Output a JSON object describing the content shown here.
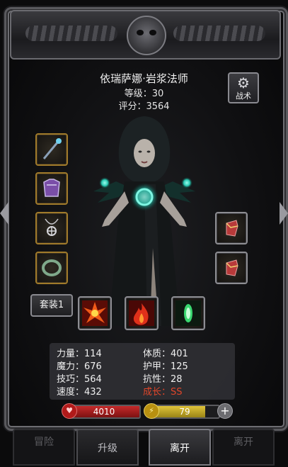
{
  "character": {
    "name": "依瑞萨娜·岩浆法师",
    "level": "等级：30",
    "score": "评分：3564"
  },
  "tactics_button": {
    "label": "战术",
    "icon": "gear-icon"
  },
  "equipment_slots": [
    {
      "slot": "weapon",
      "icon": "staff-icon"
    },
    {
      "slot": "armor",
      "icon": "chest-armor-icon"
    },
    {
      "slot": "amulet",
      "icon": "amulet-icon"
    },
    {
      "slot": "ring",
      "icon": "ring-icon"
    }
  ],
  "consumable_slots": [
    {
      "icon": "potion-pouch-icon"
    },
    {
      "icon": "potion-pouch-icon"
    }
  ],
  "set_button": {
    "label": "套装1"
  },
  "skills": [
    {
      "icon": "fire-burst-icon",
      "color": "#e8401a"
    },
    {
      "icon": "flame-icon",
      "color": "#d82a10"
    },
    {
      "icon": "green-glow-icon",
      "color": "#3ad870"
    }
  ],
  "stats": {
    "strength": "力量：114",
    "magic": "魔力：676",
    "skill": "技巧：564",
    "speed": "速度：432",
    "constitution": "体质：401",
    "armor": "护甲：125",
    "resistance": "抗性：28",
    "growth": "成长：SS"
  },
  "bars": {
    "hp": "4010",
    "mp": "79",
    "mp_fill_percent": 80
  },
  "bottom_nav": {
    "adventure": "冒险",
    "upgrade": "升级",
    "leave_main": "离开",
    "leave_faded": "离开"
  },
  "colors": {
    "frame": "#5a5a5e",
    "gold_slot": "#a07a2a",
    "hp": "#c62a2a",
    "mp": "#e0c43a",
    "growth": "#e0462a"
  }
}
